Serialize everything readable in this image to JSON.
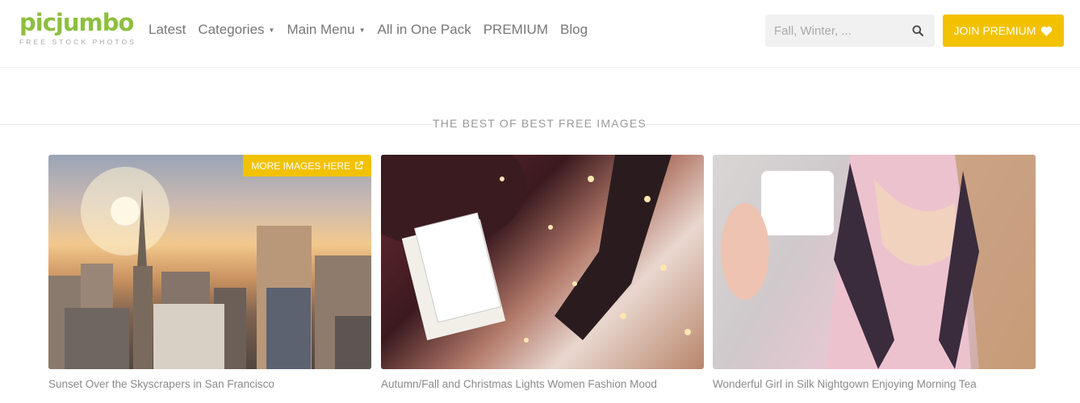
{
  "header": {
    "logo": {
      "word": "picjumbo",
      "tagline": "FREE STOCK PHOTOS"
    },
    "nav": [
      {
        "label": "Latest",
        "has_dropdown": false
      },
      {
        "label": "Categories",
        "has_dropdown": true
      },
      {
        "label": "Main Menu",
        "has_dropdown": true
      },
      {
        "label": "All in One Pack",
        "has_dropdown": false
      },
      {
        "label": "PREMIUM",
        "has_dropdown": false
      },
      {
        "label": "Blog",
        "has_dropdown": false
      }
    ],
    "search": {
      "placeholder": "Fall, Winter, ...",
      "icon": "search-icon"
    },
    "join_button": {
      "label": "JOIN PREMIUM",
      "icon": "heart-icon"
    }
  },
  "section": {
    "title": "THE BEST OF BEST FREE IMAGES"
  },
  "cards": [
    {
      "caption": "Sunset Over the Skyscrapers in San Francisco",
      "badge": "MORE IMAGES HERE",
      "badge_icon": "external-link-icon"
    },
    {
      "caption": "Autumn/Fall and Christmas Lights Women Fashion Mood"
    },
    {
      "caption": "Wonderful Girl in Silk Nightgown Enjoying Morning Tea"
    }
  ],
  "colors": {
    "brand_green": "#8dbf3f",
    "accent_yellow": "#f2c200"
  }
}
